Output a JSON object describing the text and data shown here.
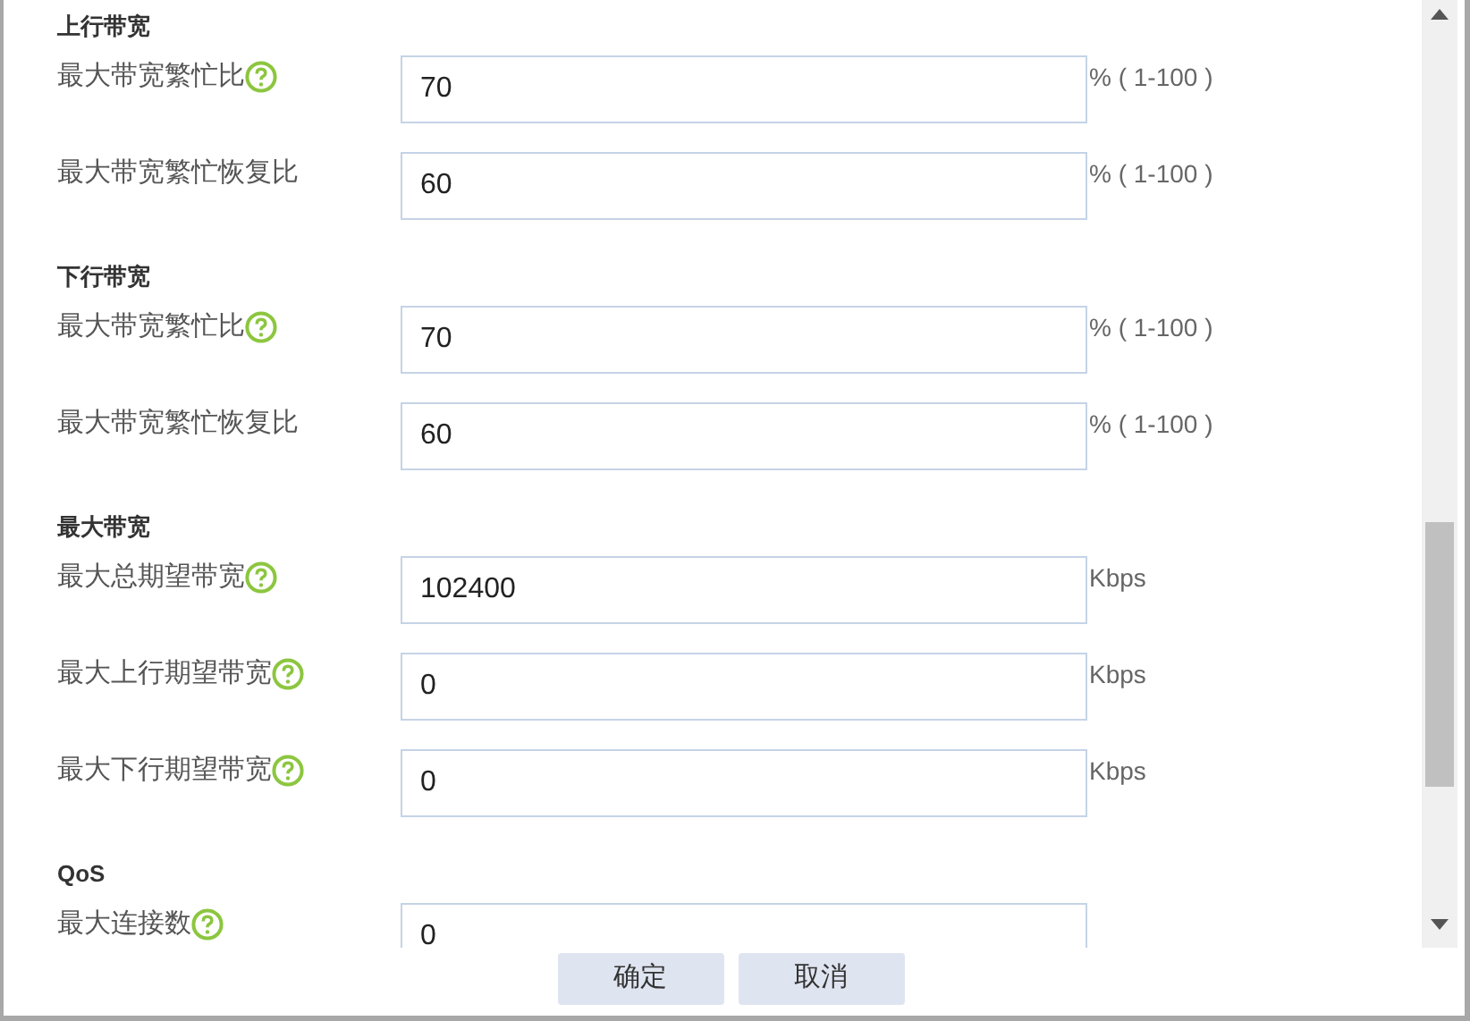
{
  "sections": [
    {
      "title": "上行带宽",
      "rows": [
        {
          "label": "最大带宽繁忙比",
          "help": true,
          "value": "70",
          "unit": "% ( 1-100 )"
        },
        {
          "label": "最大带宽繁忙恢复比",
          "help": false,
          "value": "60",
          "unit": "% ( 1-100 )"
        }
      ]
    },
    {
      "title": "下行带宽",
      "rows": [
        {
          "label": "最大带宽繁忙比",
          "help": true,
          "value": "70",
          "unit": "% ( 1-100 )"
        },
        {
          "label": "最大带宽繁忙恢复比",
          "help": false,
          "value": "60",
          "unit": "% ( 1-100 )"
        }
      ]
    },
    {
      "title": "最大带宽",
      "rows": [
        {
          "label": "最大总期望带宽",
          "help": true,
          "value": "102400",
          "unit": "Kbps"
        },
        {
          "label": "最大上行期望带宽",
          "help": true,
          "value": "0",
          "unit": "Kbps"
        },
        {
          "label": "最大下行期望带宽",
          "help": true,
          "value": "0",
          "unit": "Kbps"
        }
      ]
    },
    {
      "title": "QoS",
      "rows": [
        {
          "label": "最大连接数",
          "help": true,
          "value": "0"
        }
      ]
    }
  ],
  "buttons": [
    "确定",
    "取消"
  ]
}
